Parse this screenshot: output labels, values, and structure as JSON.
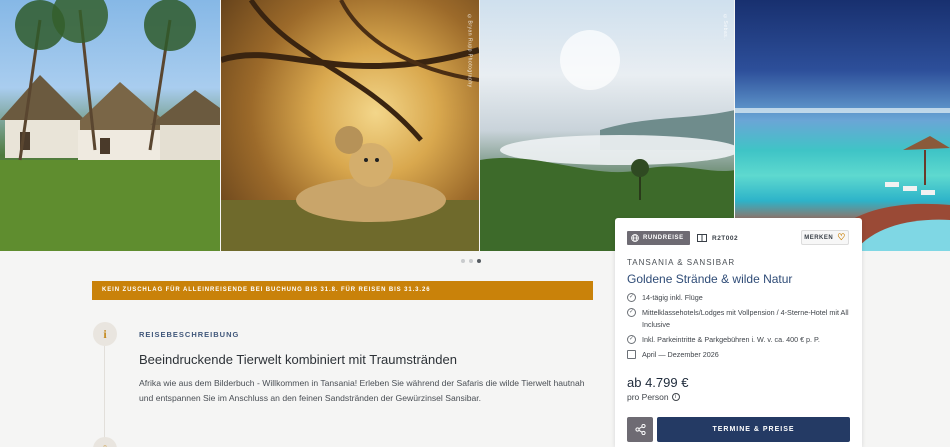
{
  "gallery": {
    "photos": [
      {
        "alt": "beach-huts-palms"
      },
      {
        "alt": "cheetah-cubs"
      },
      {
        "alt": "mountain-clouds"
      },
      {
        "alt": "ocean-pool"
      }
    ],
    "credit2": "©Bryan Rupp Photography",
    "credit3": "©Sebas..",
    "dots": [
      false,
      false,
      true
    ]
  },
  "banner": {
    "text": "Kein Zuschlag für Alleinreisende bei Buchung bis 31.8. für Reisen bis 31.3.26"
  },
  "section": {
    "label": "REISEBESCHREIBUNG",
    "title": "Beeindruckende Tierwelt kombiniert mit Traumstränden",
    "text": "Afrika wie aus dem Bilderbuch - Willkommen in Tansania! Erleben Sie während der Safaris die wilde Tierwelt hautnah und entspannen Sie im Anschluss an den feinen Sandstränden der Gewürzinsel Sansibar.",
    "info_icon": "i"
  },
  "card": {
    "badge": "RUNDREISE",
    "code": "R2T002",
    "merken": "MERKEN",
    "destination": "TANSANIA & SANSIBAR",
    "title": "Goldene Strände & wilde Natur",
    "features": [
      {
        "icon": "check-circle-icon",
        "text": "14-tägig inkl. Flüge"
      },
      {
        "icon": "check-circle-icon",
        "text": "Mittelklassehotels/Lodges mit Vollpension / 4-Sterne-Hotel mit All Inclusive"
      },
      {
        "icon": "check-circle-icon",
        "text": "Inkl. Parkeintritte & Parkgebühren i. W. v. ca. 400 € p. P."
      },
      {
        "icon": "calendar-icon",
        "text": "April — Dezember 2026"
      }
    ],
    "price": "ab 4.799 €",
    "per": "pro Person",
    "cta": "TERMINE & PREISE"
  },
  "colors": {
    "accent": "#c9820a",
    "navy": "#243a64",
    "badge": "#6e6b73"
  }
}
